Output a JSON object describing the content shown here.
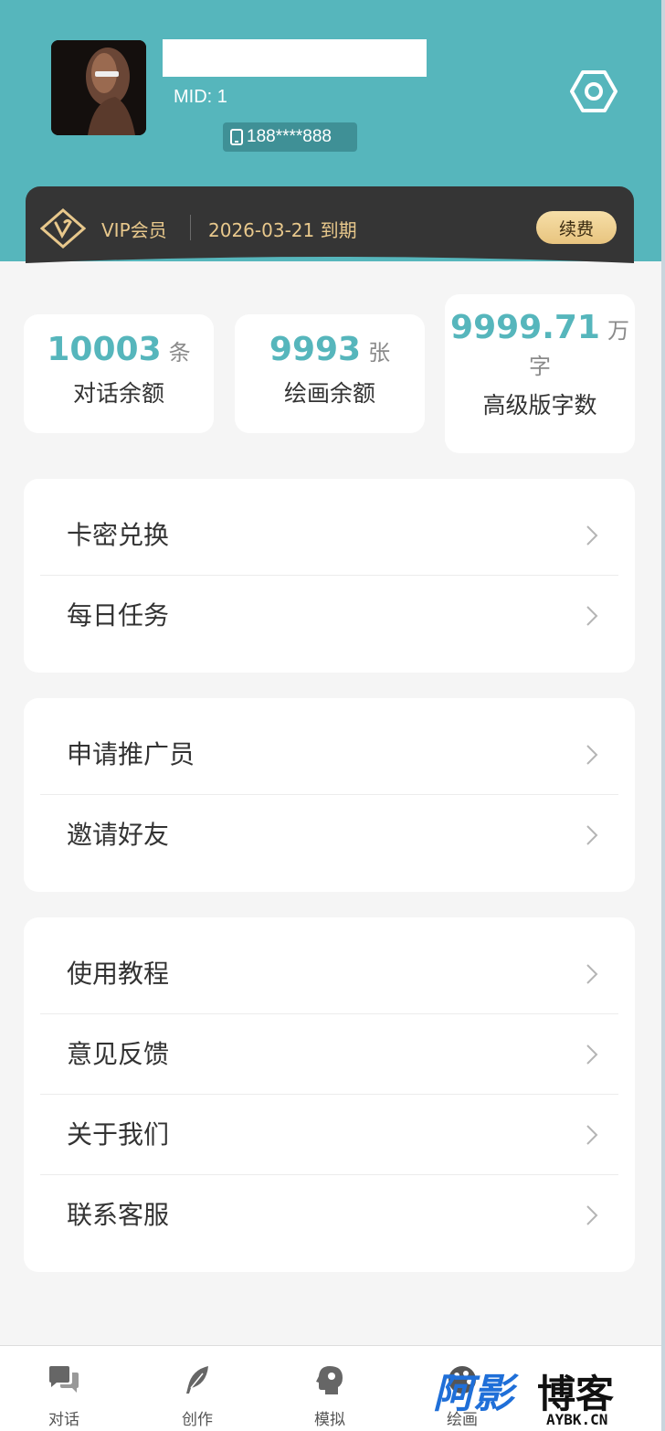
{
  "profile": {
    "mid": "MID: 1",
    "phone": "188****888"
  },
  "vip": {
    "label": "VIP会员",
    "expire": "2026-03-21 到期",
    "renew_label": "续费",
    "gold": "#e8c88c"
  },
  "stats": [
    {
      "value": "10003",
      "unit": "条",
      "label": "对话余额"
    },
    {
      "value": "9993",
      "unit": "张",
      "label": "绘画余额"
    },
    {
      "value": "9999.71",
      "unit": "万",
      "unit2": "字",
      "label": "高级版字数"
    }
  ],
  "menu_groups": [
    {
      "items": [
        "卡密兑换",
        "每日任务"
      ]
    },
    {
      "items": [
        "申请推广员",
        "邀请好友"
      ]
    },
    {
      "items": [
        "使用教程",
        "意见反馈",
        "关于我们",
        "联系客服"
      ]
    }
  ],
  "tabbar": [
    {
      "label": "对话",
      "icon": "chat-bubbles-icon"
    },
    {
      "label": "创作",
      "icon": "feather-icon"
    },
    {
      "label": "模拟",
      "icon": "head-profile-icon"
    },
    {
      "label": "绘画",
      "icon": "palette-icon"
    }
  ],
  "watermark": {
    "main": "阿影博客",
    "sub": "AYBK.CN"
  },
  "colors": {
    "primary": "#56b6bc",
    "dark_card": "#353535",
    "background": "#f5f5f5"
  }
}
